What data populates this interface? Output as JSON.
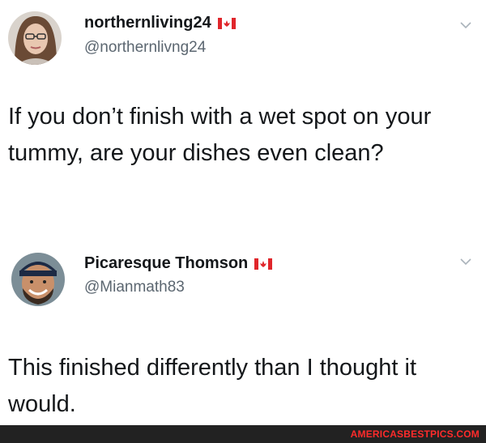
{
  "tweets": [
    {
      "display_name": "northernliving24",
      "handle": "@northernlivng24",
      "text": "If you don’t finish with a wet spot on your tummy, are your dishes even clean?"
    },
    {
      "display_name": "Picaresque Thomson",
      "handle": "@Mianmath83",
      "text": "This finished differently than I thought it would."
    }
  ],
  "watermark": "AMERICASBESTPICS.COM",
  "icons": {
    "flag": "canada-flag-icon",
    "menu": "chevron-down-icon",
    "avatar1": "avatar-woman",
    "avatar2": "avatar-man-cap"
  },
  "colors": {
    "flag_red": "#e0262b",
    "handle_gray": "#5b6670",
    "watermark_red": "#ff2b2b"
  }
}
